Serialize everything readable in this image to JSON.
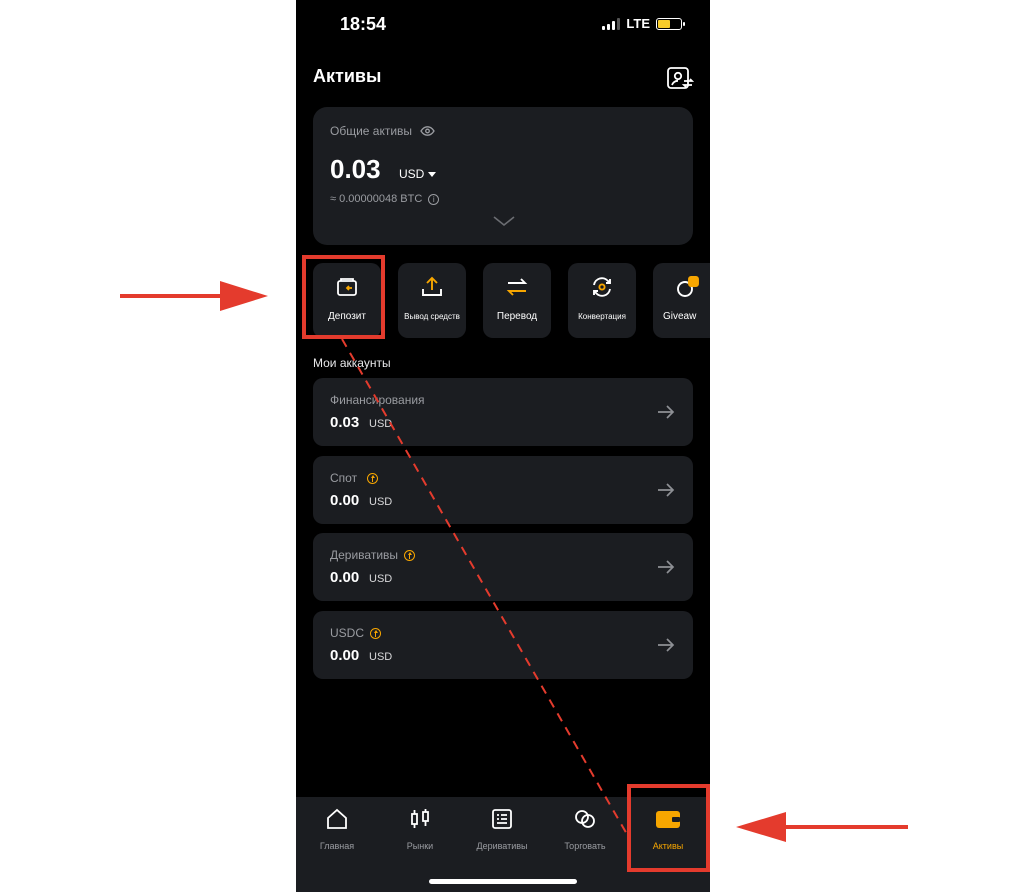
{
  "status_bar": {
    "time": "18:54",
    "network": "LTE"
  },
  "header": {
    "title": "Активы"
  },
  "total_assets": {
    "label": "Общие активы",
    "value": "0.03",
    "currency": "USD",
    "btc_equivalent": "≈ 0.00000048 BTC"
  },
  "actions": [
    {
      "label": "Депозит",
      "icon": "deposit-wallet-icon"
    },
    {
      "label": "Вывод средств",
      "icon": "upload-icon"
    },
    {
      "label": "Перевод",
      "icon": "transfer-arrows-icon"
    },
    {
      "label": "Конвертация",
      "icon": "convert-icon"
    },
    {
      "label": "Giveaw",
      "icon": "giveaway-icon"
    }
  ],
  "accounts_section_title": "Мои аккаунты",
  "accounts": [
    {
      "name": "Финансирования",
      "value": "0.03",
      "currency": "USD"
    },
    {
      "name": "Спот",
      "value": "0.00",
      "currency": "USD"
    },
    {
      "name": "Деривативы",
      "value": "0.00",
      "currency": "USD"
    },
    {
      "name": "USDC",
      "value": "0.00",
      "currency": "USD"
    }
  ],
  "bottom_nav": [
    {
      "label": "Главная",
      "icon": "home-icon"
    },
    {
      "label": "Рынки",
      "icon": "candlestick-icon"
    },
    {
      "label": "Деривативы",
      "icon": "derivatives-icon"
    },
    {
      "label": "Торговать",
      "icon": "trade-icon"
    },
    {
      "label": "Активы",
      "icon": "wallet-icon",
      "active": true
    }
  ],
  "colors": {
    "accent": "#f7a600",
    "card": "#1b1d21",
    "annotation": "#e43b2d"
  }
}
